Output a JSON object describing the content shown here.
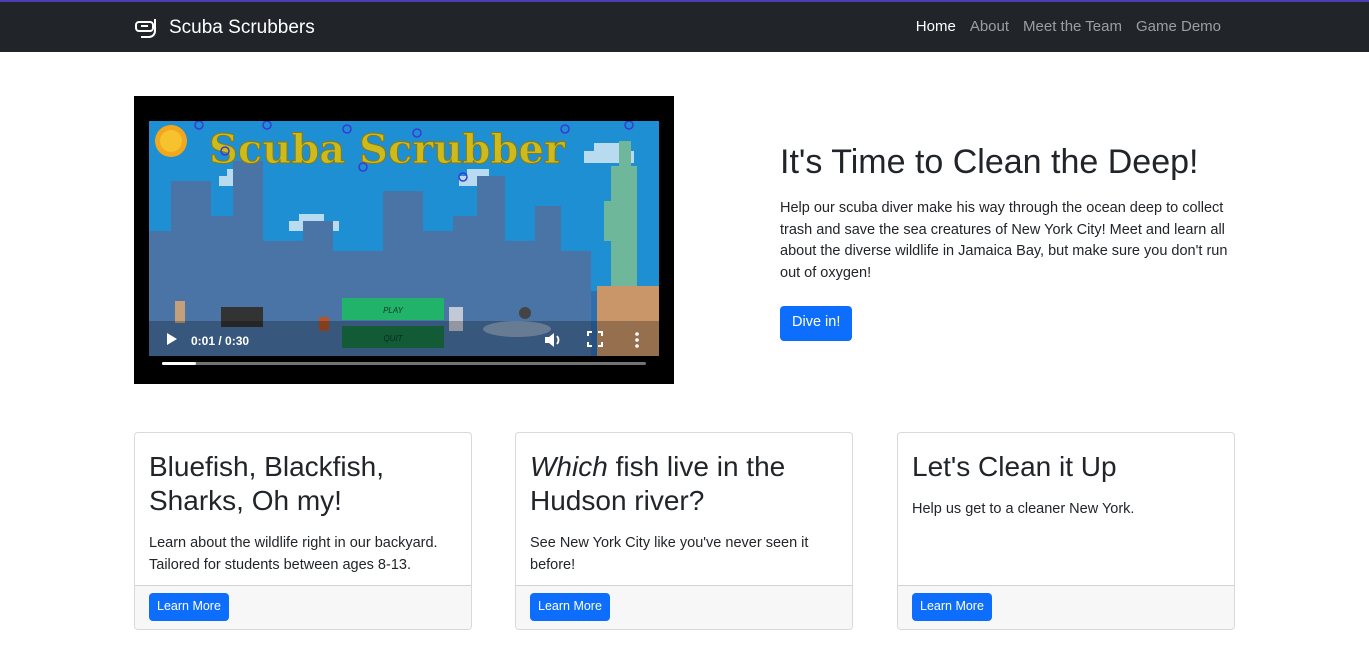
{
  "navbar": {
    "brand": "Scuba Scrubbers",
    "brand_icon": "diving-mask-icon",
    "links": [
      {
        "label": "Home",
        "active": true
      },
      {
        "label": "About",
        "active": false
      },
      {
        "label": "Meet the Team",
        "active": false
      },
      {
        "label": "Game Demo",
        "active": false
      }
    ]
  },
  "video": {
    "title_art": "Scuba Scrubber",
    "menu_play": "PLAY",
    "menu_quit": "QUIT",
    "time": "0:01 / 0:30",
    "progress": 0.07
  },
  "hero": {
    "title": "It's Time to Clean the Deep!",
    "text": "Help our scuba diver make his way through the ocean deep to collect trash and save the sea creatures of New York City! Meet and learn all about the diverse wildlife in Jamaica Bay, but make sure you don't run out of oxygen!",
    "button": "Dive in!"
  },
  "cards": [
    {
      "title_plain": "Bluefish, Blackfish, Sharks, Oh my!",
      "title_em": "",
      "text": "Learn about the wildlife right in our backyard. Tailored for students between ages 8-13.",
      "button": "Learn More"
    },
    {
      "title_em": "Which",
      "title_plain": " fish live in the Hudson river?",
      "text": "See New York City like you've never seen it before!",
      "button": "Learn More"
    },
    {
      "title_plain": "Let's Clean it Up",
      "title_em": "",
      "text": "Help us get to a cleaner New York.",
      "button": "Learn More"
    }
  ],
  "colors": {
    "navbar_bg": "#212529",
    "primary": "#0d6efd",
    "card_footer_bg": "#f7f7f7"
  }
}
